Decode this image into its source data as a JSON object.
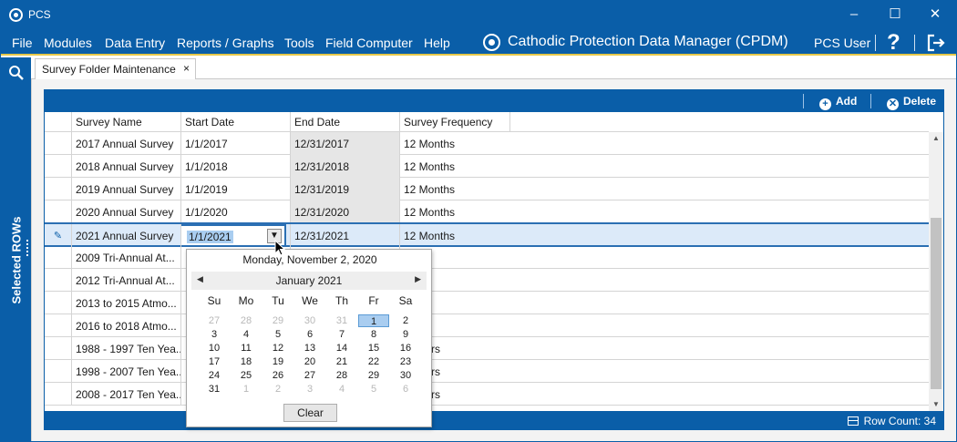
{
  "window": {
    "title": "PCS"
  },
  "menu": {
    "items": [
      "File",
      "Modules",
      "Data Entry",
      "Reports / Graphs",
      "Tools",
      "Field Computer",
      "Help"
    ],
    "app_title": "Cathodic Protection Data Manager (CPDM)",
    "user": "PCS User",
    "help": "?"
  },
  "sidebar": {
    "label": "Selected ROWs"
  },
  "tab": {
    "label": "Survey Folder Maintenance",
    "close": "×"
  },
  "toolbar": {
    "add": "Add",
    "delete": "Delete"
  },
  "grid": {
    "columns": [
      "Survey Name",
      "Start Date",
      "End Date",
      "Survey Frequency"
    ],
    "rows": [
      [
        "2017 Annual Survey",
        "1/1/2017",
        "12/31/2017",
        "12 Months"
      ],
      [
        "2018 Annual Survey",
        "1/1/2018",
        "12/31/2018",
        "12 Months"
      ],
      [
        "2019 Annual Survey",
        "1/1/2019",
        "12/31/2019",
        "12 Months"
      ],
      [
        "2020 Annual Survey",
        "1/1/2020",
        "12/31/2020",
        "12 Months"
      ],
      [
        "2021 Annual Survey",
        "1/1/2021",
        "12/31/2021",
        "12 Months"
      ],
      [
        "2009 Tri-Annual At...",
        "",
        "",
        ""
      ],
      [
        "2012 Tri-Annual At...",
        "",
        "",
        ""
      ],
      [
        "2013 to 2015 Atmo...",
        "",
        "",
        ""
      ],
      [
        "2016 to 2018 Atmo...",
        "",
        "",
        ""
      ],
      [
        "1988 - 1997 Ten Yea...",
        "",
        "",
        "rs"
      ],
      [
        "1998 - 2007 Ten Yea...",
        "",
        "",
        "rs"
      ],
      [
        "2008 - 2017 Ten Yea...",
        "",
        "",
        "rs"
      ]
    ],
    "row_count_label": "Row Count:",
    "row_count": "34"
  },
  "calendar": {
    "today": "Monday, November 2, 2020",
    "month": "January 2021",
    "dow": [
      "Su",
      "Mo",
      "Tu",
      "We",
      "Th",
      "Fr",
      "Sa"
    ],
    "weeks": [
      [
        [
          "27",
          1
        ],
        [
          "28",
          1
        ],
        [
          "29",
          1
        ],
        [
          "30",
          1
        ],
        [
          "31",
          1
        ],
        [
          "1",
          0
        ],
        [
          "2",
          0
        ]
      ],
      [
        [
          "3",
          0
        ],
        [
          "4",
          0
        ],
        [
          "5",
          0
        ],
        [
          "6",
          0
        ],
        [
          "7",
          0
        ],
        [
          "8",
          0
        ],
        [
          "9",
          0
        ]
      ],
      [
        [
          "10",
          0
        ],
        [
          "11",
          0
        ],
        [
          "12",
          0
        ],
        [
          "13",
          0
        ],
        [
          "14",
          0
        ],
        [
          "15",
          0
        ],
        [
          "16",
          0
        ]
      ],
      [
        [
          "17",
          0
        ],
        [
          "18",
          0
        ],
        [
          "19",
          0
        ],
        [
          "20",
          0
        ],
        [
          "21",
          0
        ],
        [
          "22",
          0
        ],
        [
          "23",
          0
        ]
      ],
      [
        [
          "24",
          0
        ],
        [
          "25",
          0
        ],
        [
          "26",
          0
        ],
        [
          "27",
          0
        ],
        [
          "28",
          0
        ],
        [
          "29",
          0
        ],
        [
          "30",
          0
        ]
      ],
      [
        [
          "31",
          0
        ],
        [
          "1",
          1
        ],
        [
          "2",
          1
        ],
        [
          "3",
          1
        ],
        [
          "4",
          1
        ],
        [
          "5",
          1
        ],
        [
          "6",
          1
        ]
      ]
    ],
    "selected": "1",
    "clear": "Clear"
  }
}
